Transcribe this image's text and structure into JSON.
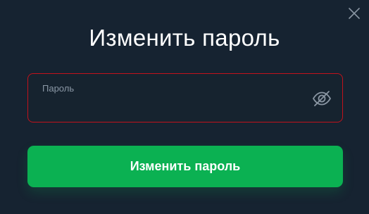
{
  "dialog": {
    "title": "Изменить пароль",
    "close_icon": "close-icon"
  },
  "password_field": {
    "label": "Пароль",
    "value": "",
    "placeholder": "",
    "toggle_icon": "eye-off-icon",
    "state": "error",
    "border_color": "#c2121c"
  },
  "submit": {
    "label": "Изменить пароль",
    "color": "#0bb152"
  },
  "colors": {
    "background": "#162331",
    "text": "#ffffff",
    "label": "#8b98a6",
    "icon": "#8a96a3"
  }
}
